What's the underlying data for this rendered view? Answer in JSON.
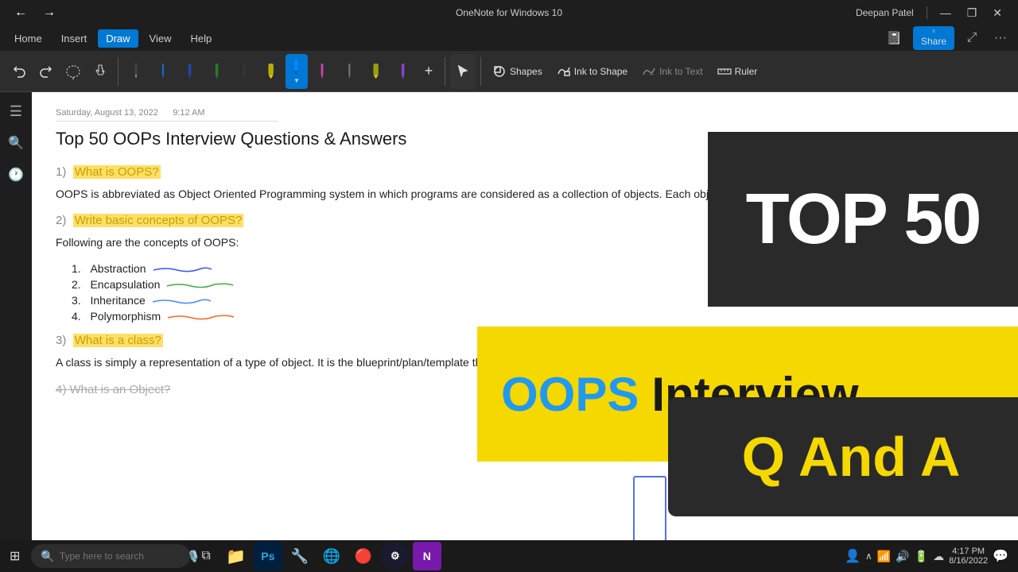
{
  "window": {
    "title": "OneNote for Windows 10",
    "user": "Deepan Patel"
  },
  "titlebar": {
    "back": "←",
    "forward": "→",
    "minimize": "—",
    "maximize": "❐",
    "close": "✕"
  },
  "menubar": {
    "items": [
      "Home",
      "Insert",
      "Draw",
      "View",
      "Help"
    ],
    "active": "Draw"
  },
  "toolbar": {
    "undo_label": "↺",
    "redo_label": "↻",
    "eraser_label": "Eraser",
    "shapes_label": "Shapes",
    "ink_to_shape_label": "Ink to Shape",
    "ink_to_text_label": "Ink to Text",
    "ruler_label": "Ruler",
    "add_label": "+"
  },
  "sidebar": {
    "items": [
      "≡",
      "🔍",
      "🕐"
    ]
  },
  "note": {
    "date": "Saturday, August 13, 2022",
    "time": "9:12 AM",
    "title": "Top 50 OOPs Interview Questions & Answers",
    "q1": "1)  What is OOPS?",
    "q1_highlight": "What is OOPS?",
    "q1_body": "OOPS is abbreviated as Object Oriented Programming system in which programs are considered as a collection of objects. Each object is nothing but an instance of a class.",
    "q2": "2)  Write basic concepts of OOPS?",
    "q2_highlight": "Write basic concepts of OOPS?",
    "q2_body": "Following are the concepts of OOPS:",
    "list_items": [
      "Abstraction",
      "Encapsulation",
      "Inheritance",
      "Polymorphism"
    ],
    "q3": "3)  What is a class?",
    "q3_highlight": "What is a class?",
    "q3_body": "A class is simply a representation of a type of object. It is the blueprint/plan/template that describes the details of an object.",
    "q4_partial": "4)  What is an Object?"
  },
  "overlay": {
    "top50_text": "TOP 50",
    "oops_text": "OOPS",
    "interview_text": "Interview",
    "qa_text": "Q And A"
  },
  "taskbar": {
    "search_placeholder": "Type here to search",
    "time": "4:17 PM",
    "date": "8/16/2022",
    "apps": [
      "⊞",
      "🔍",
      "💬",
      "📁",
      "🎨",
      "🔶",
      "🔧",
      "🌐",
      "🔴",
      "🎯",
      "🟣"
    ]
  }
}
